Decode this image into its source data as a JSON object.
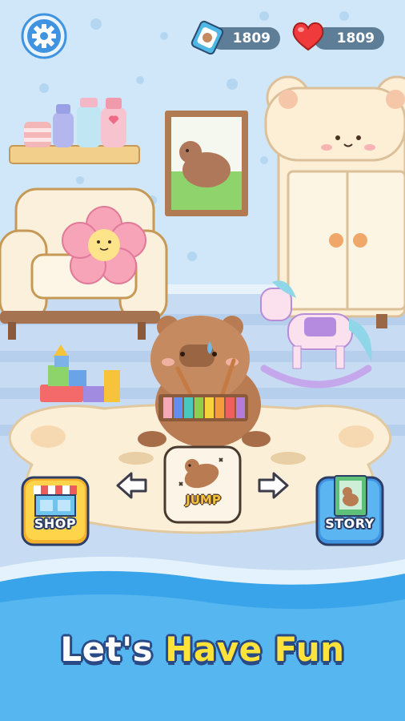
{
  "hud": {
    "gem_count": "1809",
    "heart_count": "1809"
  },
  "buttons": {
    "shop_label": "SHOP",
    "story_label": "STORY",
    "jump_label": "JUMP"
  },
  "headline": {
    "part1": "Let's",
    "part2": "Have Fun"
  },
  "icons": [
    "gear-icon",
    "gem-icon",
    "heart-icon",
    "arrow-left-icon",
    "arrow-right-icon",
    "shop-icon",
    "story-icon"
  ],
  "colors": {
    "wall": "#cfe7f8",
    "floor": "#c7dcf2",
    "water": "#3aa4ea",
    "headline_yellow": "#ffe23a",
    "hud_pill": "#5d7e96"
  }
}
